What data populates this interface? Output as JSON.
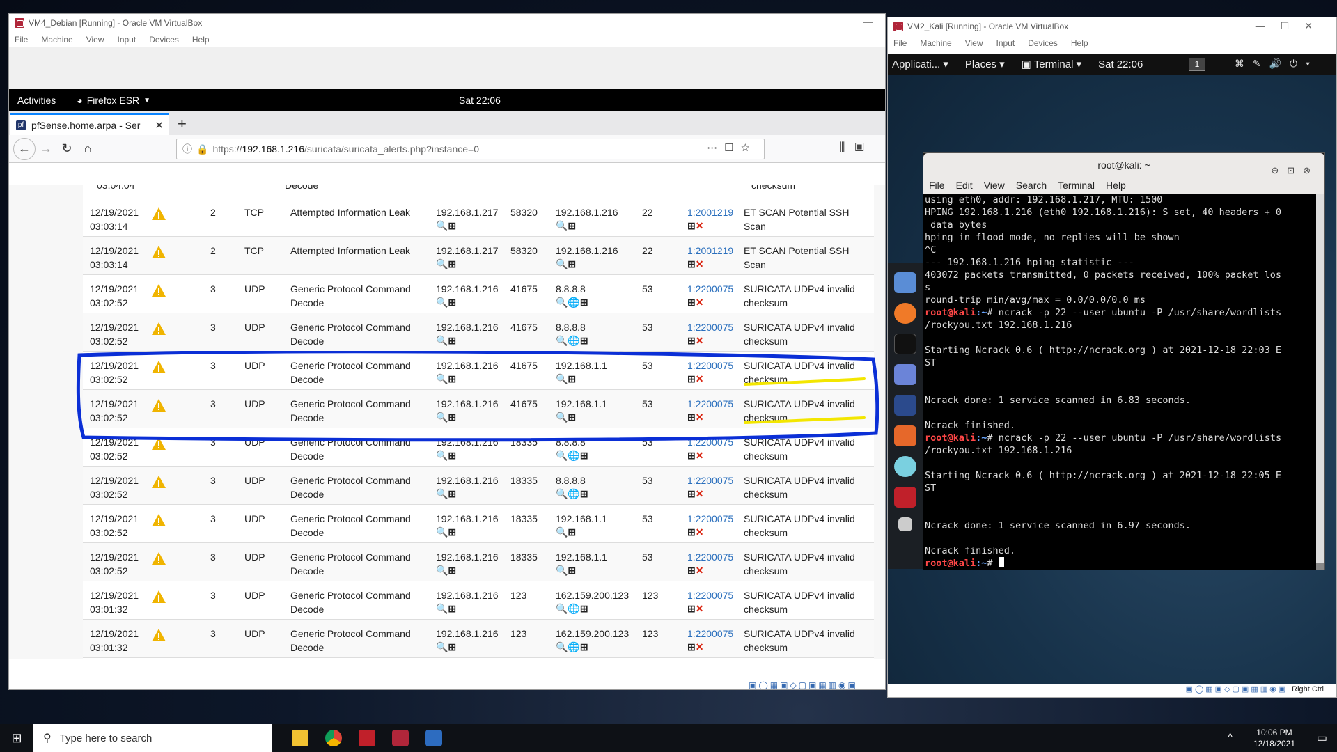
{
  "vm4": {
    "title": "VM4_Debian [Running] - Oracle VM VirtualBox",
    "menu": [
      "File",
      "Machine",
      "View",
      "Input",
      "Devices",
      "Help"
    ],
    "gnome": {
      "activities": "Activities",
      "app": "Firefox ESR",
      "clock": "Sat 22:06"
    },
    "tab": {
      "title": "pfSense.home.arpa - Ser",
      "new_tab": "+"
    },
    "url": {
      "prefix": "https://",
      "host": "192.168.1.216",
      "path": "/suricata/suricata_alerts.php?instance=0"
    },
    "partial_row": {
      "time": "03:04:04",
      "class": "Decode",
      "desc": "checksum"
    },
    "rows": [
      {
        "date": "12/19/2021",
        "time": "03:03:14",
        "pri": "2",
        "proto": "TCP",
        "class1": "Attempted Information Leak",
        "class2": "",
        "src": "192.168.1.217",
        "sport": "58320",
        "dst": "192.168.1.216",
        "dport": "22",
        "sid": "1:2001219",
        "desc1": "ET SCAN Potential SSH Scan",
        "desc2": ""
      },
      {
        "date": "12/19/2021",
        "time": "03:03:14",
        "pri": "2",
        "proto": "TCP",
        "class1": "Attempted Information Leak",
        "class2": "",
        "src": "192.168.1.217",
        "sport": "58320",
        "dst": "192.168.1.216",
        "dport": "22",
        "sid": "1:2001219",
        "desc1": "ET SCAN Potential SSH Scan",
        "desc2": ""
      },
      {
        "date": "12/19/2021",
        "time": "03:02:52",
        "pri": "3",
        "proto": "UDP",
        "class1": "Generic Protocol Command",
        "class2": "Decode",
        "src": "192.168.1.216",
        "sport": "41675",
        "dst": "8.8.8.8",
        "dport": "53",
        "sid": "1:2200075",
        "desc1": "SURICATA UDPv4 invalid",
        "desc2": "checksum"
      },
      {
        "date": "12/19/2021",
        "time": "03:02:52",
        "pri": "3",
        "proto": "UDP",
        "class1": "Generic Protocol Command",
        "class2": "Decode",
        "src": "192.168.1.216",
        "sport": "41675",
        "dst": "8.8.8.8",
        "dport": "53",
        "sid": "1:2200075",
        "desc1": "SURICATA UDPv4 invalid",
        "desc2": "checksum"
      },
      {
        "date": "12/19/2021",
        "time": "03:02:52",
        "pri": "3",
        "proto": "UDP",
        "class1": "Generic Protocol Command",
        "class2": "Decode",
        "src": "192.168.1.216",
        "sport": "41675",
        "dst": "192.168.1.1",
        "dport": "53",
        "sid": "1:2200075",
        "desc1": "SURICATA UDPv4 invalid",
        "desc2": "checksum"
      },
      {
        "date": "12/19/2021",
        "time": "03:02:52",
        "pri": "3",
        "proto": "UDP",
        "class1": "Generic Protocol Command",
        "class2": "Decode",
        "src": "192.168.1.216",
        "sport": "41675",
        "dst": "192.168.1.1",
        "dport": "53",
        "sid": "1:2200075",
        "desc1": "SURICATA UDPv4 invalid",
        "desc2": "checksum"
      },
      {
        "date": "12/19/2021",
        "time": "03:02:52",
        "pri": "3",
        "proto": "UDP",
        "class1": "Generic Protocol Command",
        "class2": "Decode",
        "src": "192.168.1.216",
        "sport": "18335",
        "dst": "8.8.8.8",
        "dport": "53",
        "sid": "1:2200075",
        "desc1": "SURICATA UDPv4 invalid",
        "desc2": "checksum"
      },
      {
        "date": "12/19/2021",
        "time": "03:02:52",
        "pri": "3",
        "proto": "UDP",
        "class1": "Generic Protocol Command",
        "class2": "Decode",
        "src": "192.168.1.216",
        "sport": "18335",
        "dst": "8.8.8.8",
        "dport": "53",
        "sid": "1:2200075",
        "desc1": "SURICATA UDPv4 invalid",
        "desc2": "checksum"
      },
      {
        "date": "12/19/2021",
        "time": "03:02:52",
        "pri": "3",
        "proto": "UDP",
        "class1": "Generic Protocol Command",
        "class2": "Decode",
        "src": "192.168.1.216",
        "sport": "18335",
        "dst": "192.168.1.1",
        "dport": "53",
        "sid": "1:2200075",
        "desc1": "SURICATA UDPv4 invalid",
        "desc2": "checksum"
      },
      {
        "date": "12/19/2021",
        "time": "03:02:52",
        "pri": "3",
        "proto": "UDP",
        "class1": "Generic Protocol Command",
        "class2": "Decode",
        "src": "192.168.1.216",
        "sport": "18335",
        "dst": "192.168.1.1",
        "dport": "53",
        "sid": "1:2200075",
        "desc1": "SURICATA UDPv4 invalid",
        "desc2": "checksum"
      },
      {
        "date": "12/19/2021",
        "time": "03:01:32",
        "pri": "3",
        "proto": "UDP",
        "class1": "Generic Protocol Command",
        "class2": "Decode",
        "src": "192.168.1.216",
        "sport": "123",
        "dst": "162.159.200.123",
        "dport": "123",
        "sid": "1:2200075",
        "desc1": "SURICATA UDPv4 invalid",
        "desc2": "checksum"
      },
      {
        "date": "12/19/2021",
        "time": "03:01:32",
        "pri": "3",
        "proto": "UDP",
        "class1": "Generic Protocol Command",
        "class2": "Decode",
        "src": "192.168.1.216",
        "sport": "123",
        "dst": "162.159.200.123",
        "dport": "123",
        "sid": "1:2200075",
        "desc1": "SURICATA UDPv4 invalid",
        "desc2": "checksum"
      }
    ]
  },
  "vm2": {
    "title": "VM2_Kali [Running] - Oracle VM VirtualBox",
    "menu": [
      "File",
      "Machine",
      "View",
      "Input",
      "Devices",
      "Help"
    ],
    "panel": {
      "applications": "Applicati...",
      "places": "Places",
      "terminal": "Terminal",
      "clock": "Sat 22:06",
      "workspace": "1"
    },
    "terminal": {
      "title": "root@kali: ~",
      "menu": [
        "File",
        "Edit",
        "View",
        "Search",
        "Terminal",
        "Help"
      ],
      "prompt_user": "root@kali",
      "prompt_path": ":~",
      "prompt_end": "# ",
      "lines_a": "using eth0, addr: 192.168.1.217, MTU: 1500\nHPING 192.168.1.216 (eth0 192.168.1.216): S set, 40 headers + 0\n data bytes\nhping in flood mode, no replies will be shown\n^C\n--- 192.168.1.216 hping statistic ---\n403072 packets transmitted, 0 packets received, 100% packet los\ns\nround-trip min/avg/max = 0.0/0.0/0.0 ms",
      "cmd1": "ncrack -p 22 --user ubuntu -P /usr/share/wordlists\n/rockyou.txt 192.168.1.216",
      "lines_b": "\nStarting Ncrack 0.6 ( http://ncrack.org ) at 2021-12-18 22:03 E\nST\n\n\nNcrack done: 1 service scanned in 6.83 seconds.\n\nNcrack finished.",
      "cmd2": "ncrack -p 22 --user ubuntu -P /usr/share/wordlists\n/rockyou.txt 192.168.1.216",
      "lines_c": "\nStarting Ncrack 0.6 ( http://ncrack.org ) at 2021-12-18 22:05 E\nST\n\n\nNcrack done: 1 service scanned in 6.97 seconds.\n\nNcrack finished."
    },
    "status_key": "Right Ctrl"
  },
  "taskbar": {
    "search_placeholder": "Type here to search",
    "time": "10:06 PM",
    "date": "12/18/2021"
  },
  "colors": {
    "annotation_blue": "#0b2fd6",
    "annotation_yellow": "#f3e600",
    "link": "#2a6fbd",
    "kali_user": "#ff4747",
    "kali_path": "#6aa6ff"
  }
}
